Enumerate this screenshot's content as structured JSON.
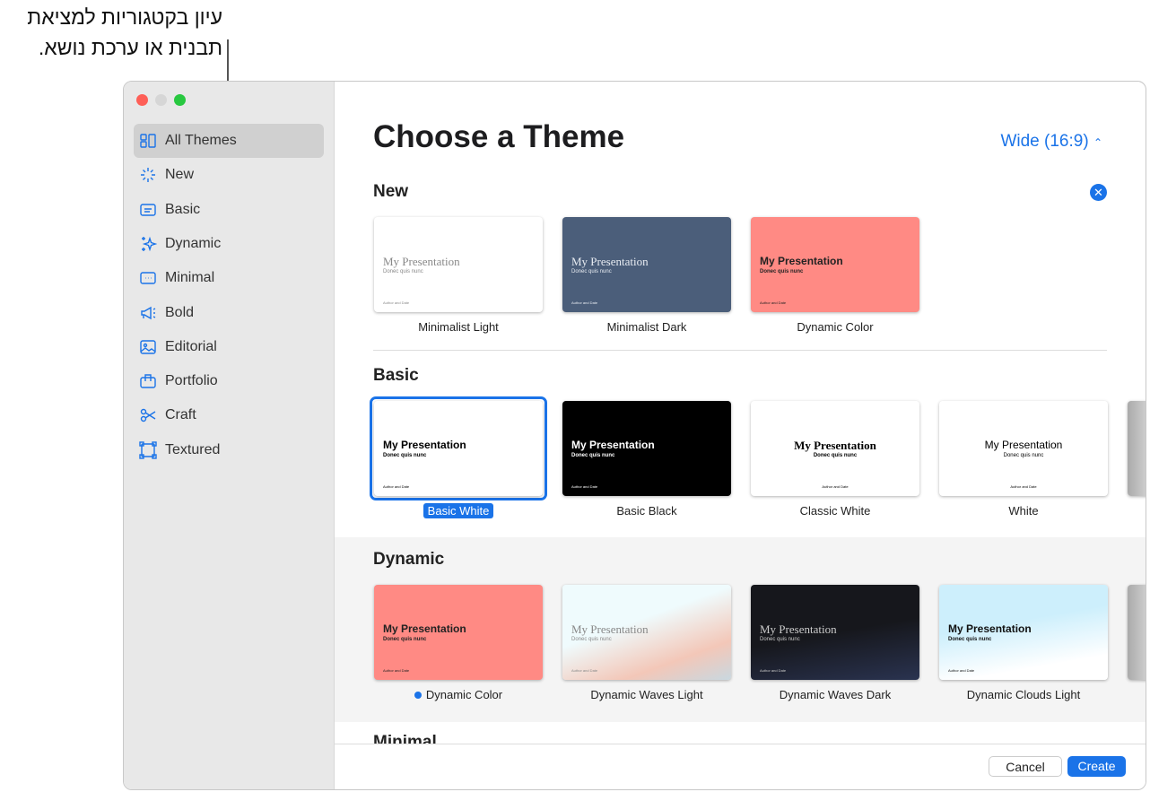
{
  "callout": {
    "line1": "עיון בקטגוריות למציאת",
    "line2": "תבנית או ערכת נושא."
  },
  "sidebar": {
    "items": [
      {
        "label": "All Themes",
        "icon": "grid-icon"
      },
      {
        "label": "New",
        "icon": "sparkle-burst-icon"
      },
      {
        "label": "Basic",
        "icon": "text-box-icon"
      },
      {
        "label": "Dynamic",
        "icon": "sparkles-icon"
      },
      {
        "label": "Minimal",
        "icon": "ellipsis-box-icon"
      },
      {
        "label": "Bold",
        "icon": "megaphone-icon"
      },
      {
        "label": "Editorial",
        "icon": "photo-icon"
      },
      {
        "label": "Portfolio",
        "icon": "briefcase-icon"
      },
      {
        "label": "Craft",
        "icon": "scissors-icon"
      },
      {
        "label": "Textured",
        "icon": "frame-icon"
      }
    ],
    "selected": "All Themes"
  },
  "header": {
    "title": "Choose a Theme",
    "ratio": "Wide (16:9)"
  },
  "thumb_text": {
    "title": "My Presentation",
    "subtitle": "Donec quis nunc",
    "footer": "Author and Date"
  },
  "sections": [
    {
      "title": "New",
      "themes": [
        "Minimalist Light",
        "Minimalist Dark",
        "Dynamic Color"
      ]
    },
    {
      "title": "Basic",
      "themes": [
        "Basic White",
        "Basic Black",
        "Classic White",
        "White"
      ]
    },
    {
      "title": "Dynamic",
      "themes": [
        "Dynamic Color",
        "Dynamic Waves Light",
        "Dynamic Waves Dark",
        "Dynamic Clouds Light"
      ]
    },
    {
      "title": "Minimal"
    }
  ],
  "selected_theme": "Basic White",
  "footer": {
    "cancel": "Cancel",
    "create": "Create"
  },
  "colors": {
    "accent": "#1a73e8",
    "coral": "#ff8a84",
    "slate": "#4b5e7a"
  }
}
